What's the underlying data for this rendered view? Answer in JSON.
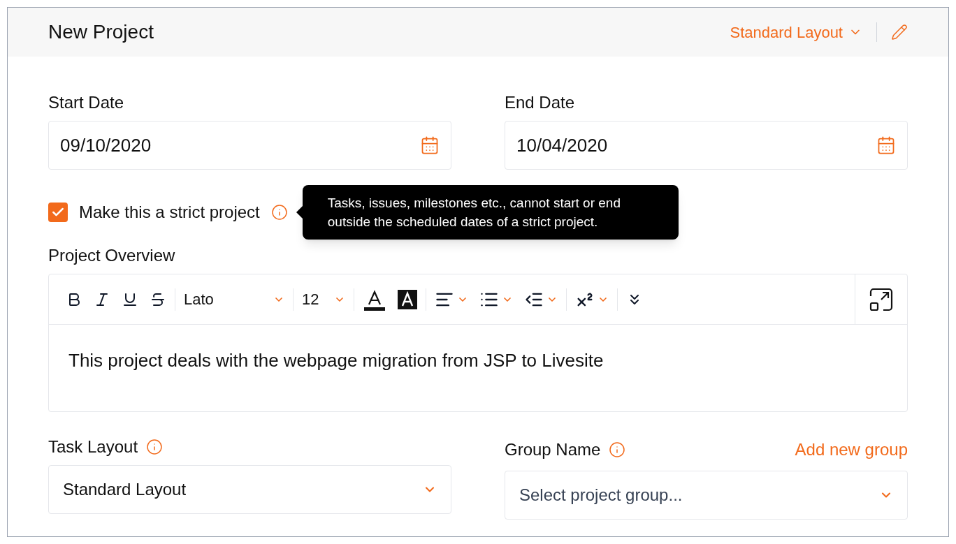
{
  "header": {
    "title": "New Project",
    "layout_menu": "Standard Layout"
  },
  "dates": [
    {
      "label": "Start Date",
      "value": "09/10/2020"
    },
    {
      "label": "End Date",
      "value": "10/04/2020"
    }
  ],
  "strict": {
    "label": "Make this a strict project",
    "checked": true,
    "tooltip": "Tasks, issues, milestones etc., cannot start or end outside the scheduled dates of a strict project."
  },
  "overview": {
    "label": "Project Overview",
    "font": "Lato",
    "size": "12",
    "text": "This project deals with the webpage migration from JSP to Livesite"
  },
  "task_layout": {
    "label": "Task Layout",
    "value": "Standard Layout"
  },
  "group": {
    "label": "Group Name",
    "link": "Add new group",
    "placeholder": "Select project group..."
  }
}
